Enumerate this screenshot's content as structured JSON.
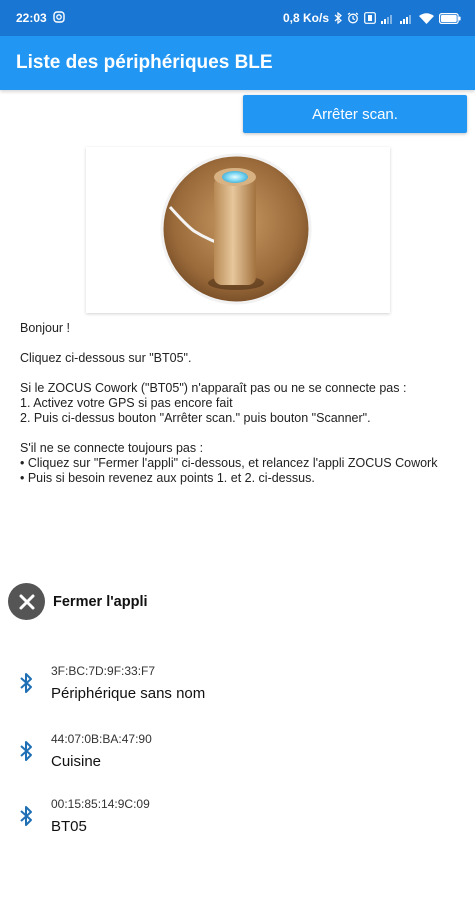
{
  "status_bar": {
    "time": "22:03",
    "net_speed": "0,8 Ko/s",
    "battery_level": 0.9
  },
  "app_bar": {
    "title": "Liste des périphériques BLE"
  },
  "scan_button": {
    "label": "Arrêter scan."
  },
  "instructions": {
    "greeting": "Bonjour !",
    "click_hint": "Cliquez ci-dessous sur \"BT05\".",
    "if_not_appear": "Si le ZOCUS Cowork (\"BT05\") n'apparaît pas ou ne se connecte pas :",
    "step1": "1. Activez votre GPS si pas encore fait",
    "step2": "2. Puis ci-dessus bouton \"Arrêter scan.\" puis bouton \"Scanner\".",
    "still_not": "S'il ne se connecte toujours pas :",
    "bullet1": "• Cliquez sur \"Fermer l'appli\" ci-dessous, et relancez l'appli ZOCUS Cowork",
    "bullet2": "• Puis si besoin revenez aux points 1. et 2. ci-dessus."
  },
  "close_app": {
    "label": "Fermer l'appli"
  },
  "devices": [
    {
      "mac": "3F:BC:7D:9F:33:F7",
      "name": "Périphérique sans nom"
    },
    {
      "mac": "44:07:0B:BA:47:90",
      "name": "Cuisine"
    },
    {
      "mac": "00:15:85:14:9C:09",
      "name": "BT05"
    }
  ],
  "colors": {
    "status_bar": "#1976d2",
    "primary": "#2196f3",
    "bluetooth_icon": "#1f6fb5",
    "close_icon_bg": "#555555"
  },
  "icons": {
    "status_left": "instagram-icon",
    "status_right": [
      "bluetooth-icon",
      "alarm-icon",
      "vibrate-icon",
      "signal-icon",
      "signal-icon",
      "wifi-icon",
      "battery-icon"
    ],
    "close": "close-icon",
    "device": "bluetooth-icon"
  }
}
